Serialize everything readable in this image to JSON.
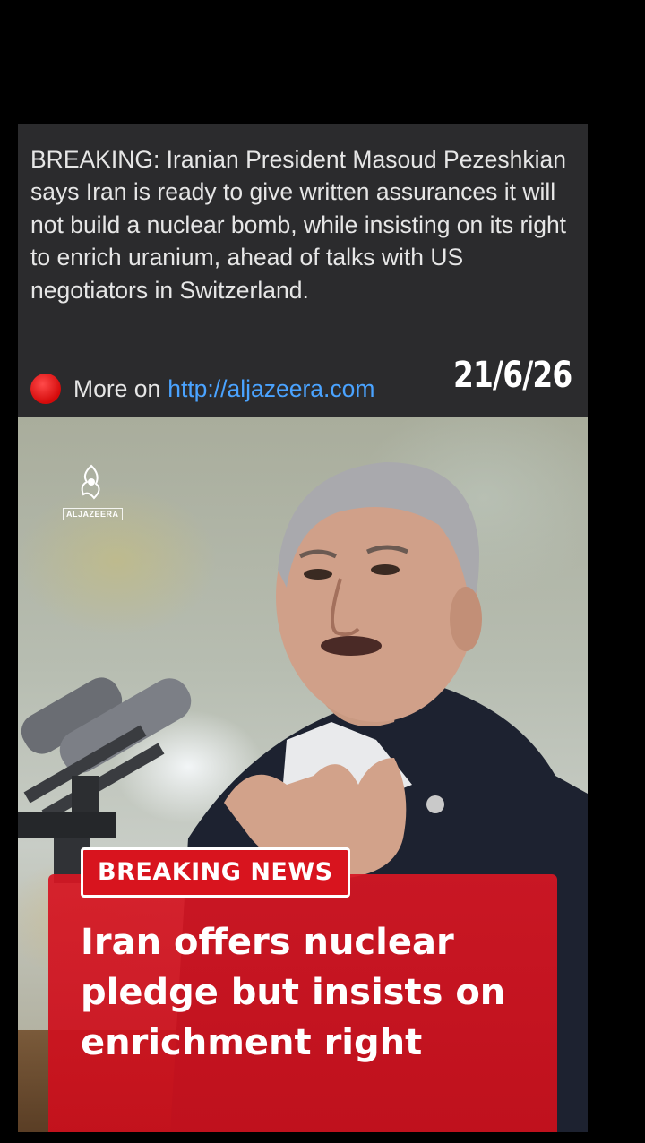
{
  "post": {
    "text": "BREAKING: Iranian President Masoud Pezeshkian says Iran is ready to give written assurances it will not build a nuclear bomb, while insisting on its right to enrich uranium, ahead of talks with US negotiators in Switzerland.",
    "more_label": "More on",
    "link": "http://aljazeera.com",
    "date": "21/6/26"
  },
  "image": {
    "logo_text": "ALJAZEERA",
    "badge": "BREAKING NEWS",
    "headline": "Iran offers nuclear pledge but insists on enrichment right"
  },
  "colors": {
    "accent_red": "#d8141e",
    "link_blue": "#4aa3ff",
    "card_bg": "#2b2b2d"
  }
}
